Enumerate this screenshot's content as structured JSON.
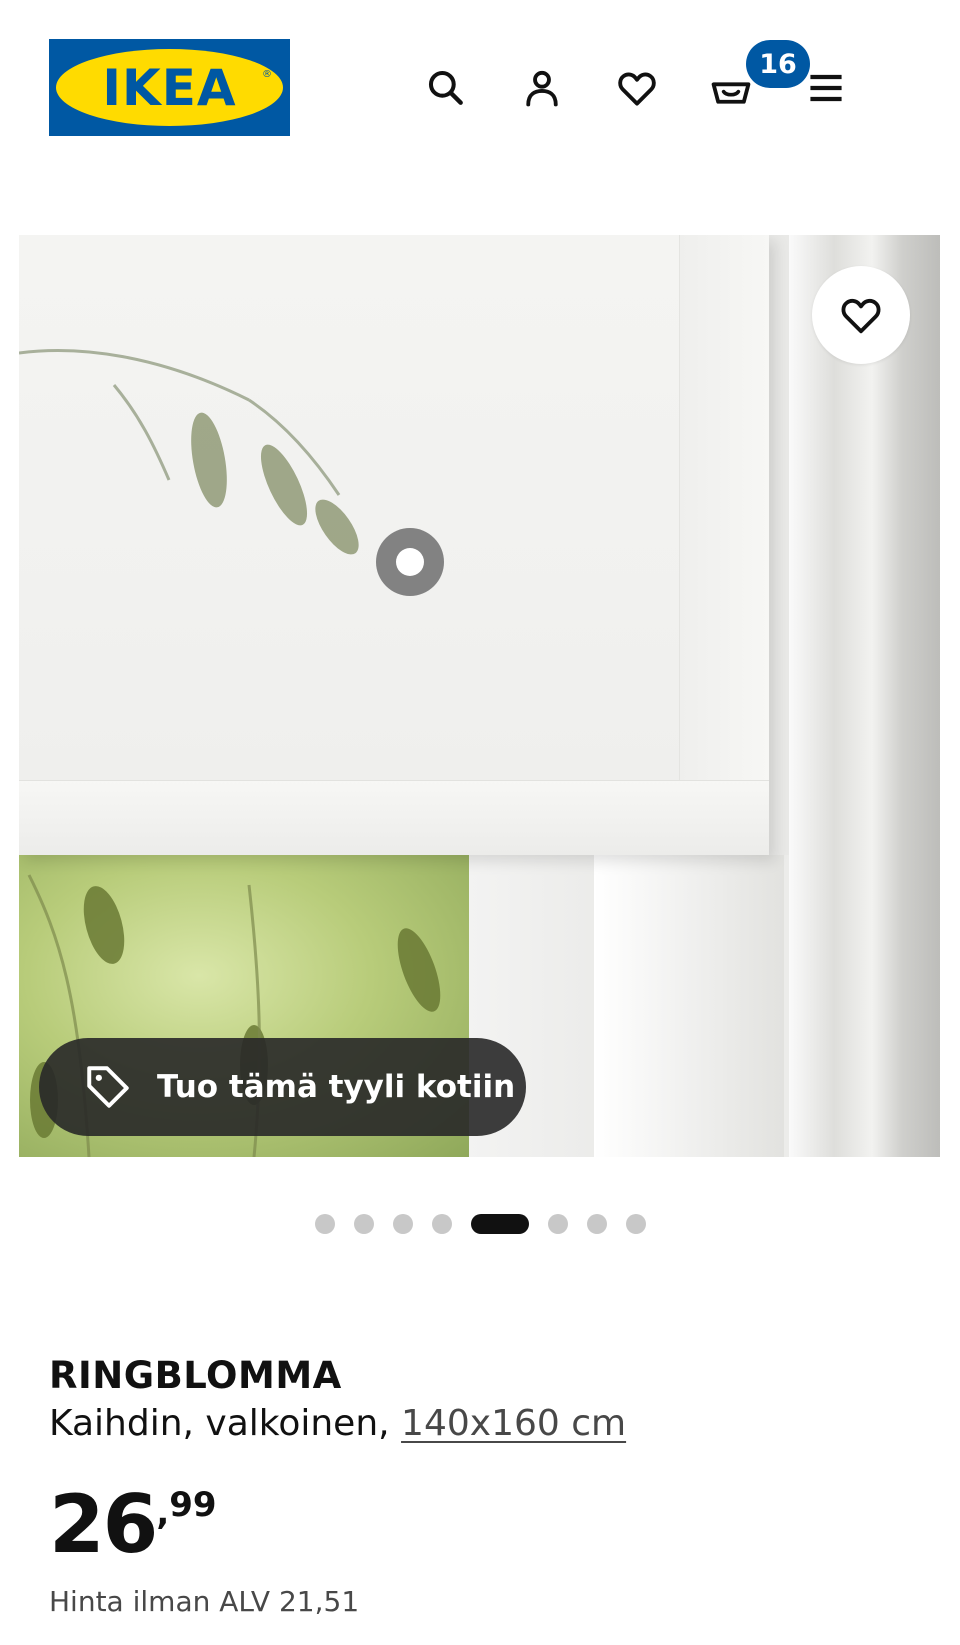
{
  "header": {
    "logo_text": "IKEA",
    "logo_registered": "®",
    "icons": [
      "search-icon",
      "user-icon",
      "heart-icon",
      "cart-icon",
      "menu-icon"
    ],
    "cart_count": "16",
    "colors": {
      "brand_blue": "#0058a3",
      "brand_yellow": "#ffdb00"
    }
  },
  "hero": {
    "favorite_icon": "heart-icon",
    "hotspot_icon": "hotspot-dot",
    "style_button": {
      "icon": "tag-icon",
      "label": "Tuo tämä tyyli kotiin"
    }
  },
  "carousel": {
    "total": 8,
    "active_index": 4
  },
  "product": {
    "name": "RINGBLOMMA",
    "description": "Kaihdin, valkoinen, ",
    "size_link": "140x160 cm",
    "price_integer": "26",
    "price_separator": ",",
    "price_decimal": "99",
    "vat_text": "Hinta ilman ALV 21,51"
  }
}
